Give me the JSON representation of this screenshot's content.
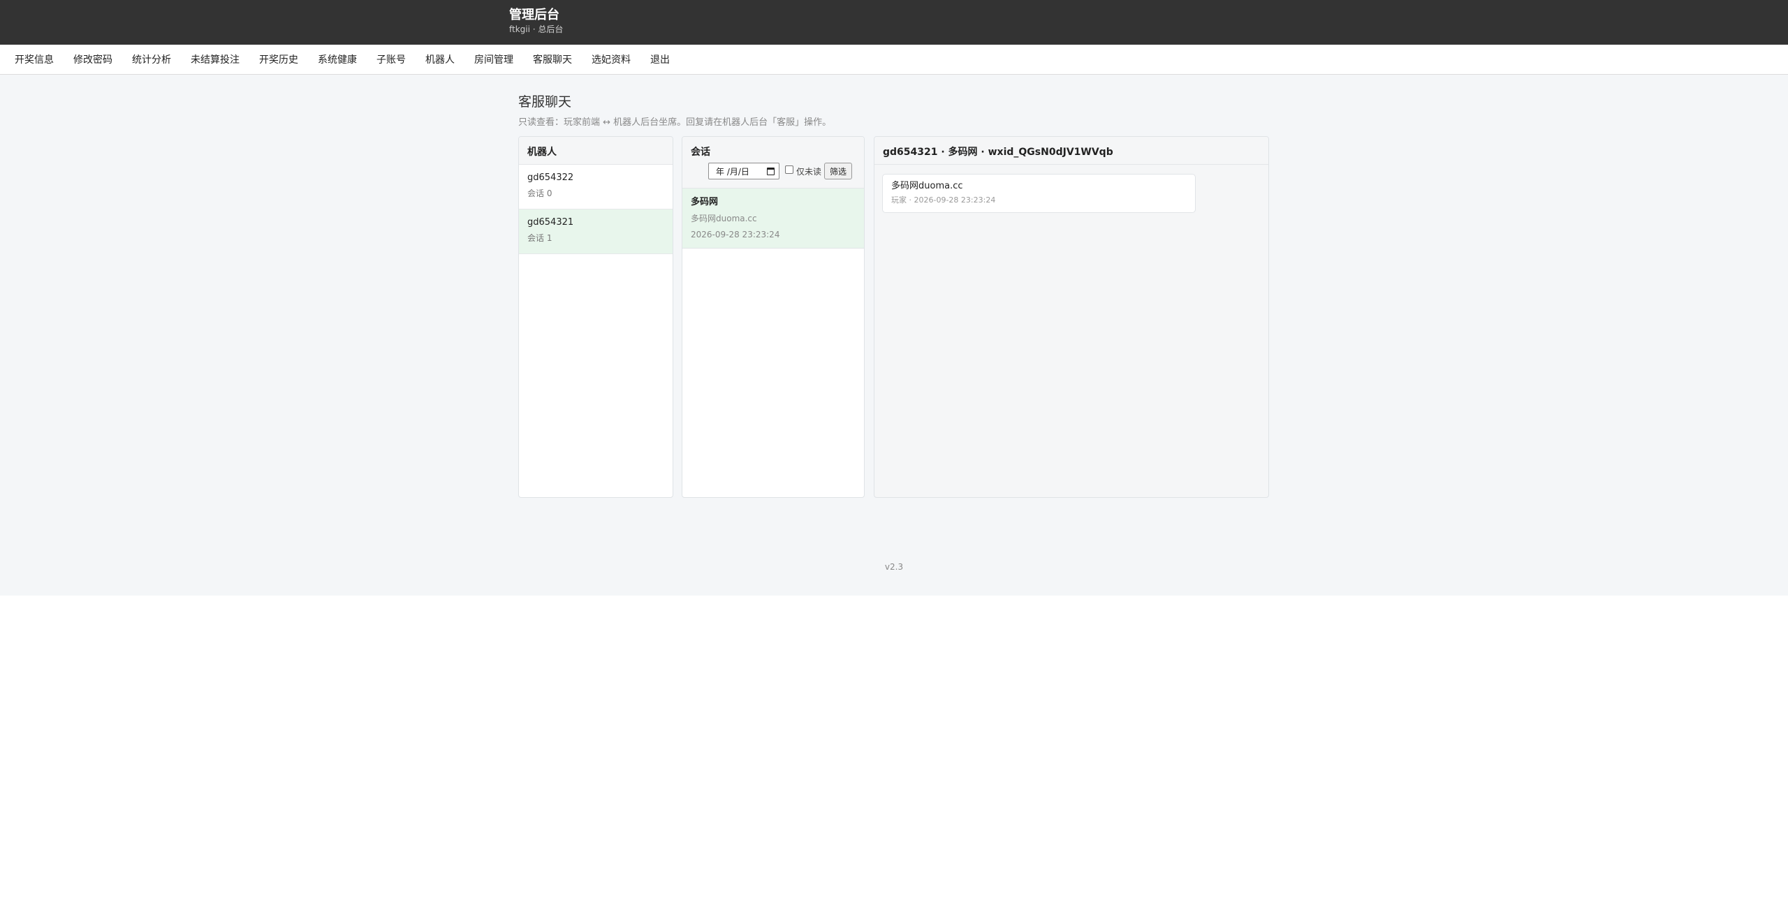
{
  "header": {
    "title": "管理后台",
    "subtitle": "ftkgii · 总后台"
  },
  "nav": {
    "items": [
      "开奖信息",
      "修改密码",
      "统计分析",
      "未结算投注",
      "开奖历史",
      "系统健康",
      "子账号",
      "机器人",
      "房间管理",
      "客服聊天",
      "选妃资料",
      "退出"
    ]
  },
  "page": {
    "title": "客服聊天",
    "note": "只读查看：玩家前端 ↔ 机器人后台坐席。回复请在机器人后台「客服」操作。"
  },
  "robots": {
    "heading": "机器人",
    "items": [
      {
        "name": "gd654322",
        "count": "会话 0",
        "active": false
      },
      {
        "name": "gd654321",
        "count": "会话 1",
        "active": true
      }
    ]
  },
  "sessions": {
    "heading": "会话",
    "date_placeholder": "年 /月/日",
    "unread_only_label": "仅未读",
    "unread_only_checked": false,
    "filter_button": "筛选",
    "items": [
      {
        "name": "多码网",
        "preview": "多码网duoma.cc",
        "time": "2026-09-28 23:23:24"
      }
    ]
  },
  "chat": {
    "heading": "gd654321 · 多码网 · wxid_QGsN0dJV1WVqb",
    "messages": [
      {
        "text": "多码网duoma.cc",
        "meta": "玩家 · 2026-09-28 23:23:24"
      }
    ]
  },
  "footer": {
    "version": "v2.3"
  },
  "colors": {
    "topbar": "#333333",
    "active_row": "#e8f6ec",
    "page_bg": "#f4f6f8"
  }
}
